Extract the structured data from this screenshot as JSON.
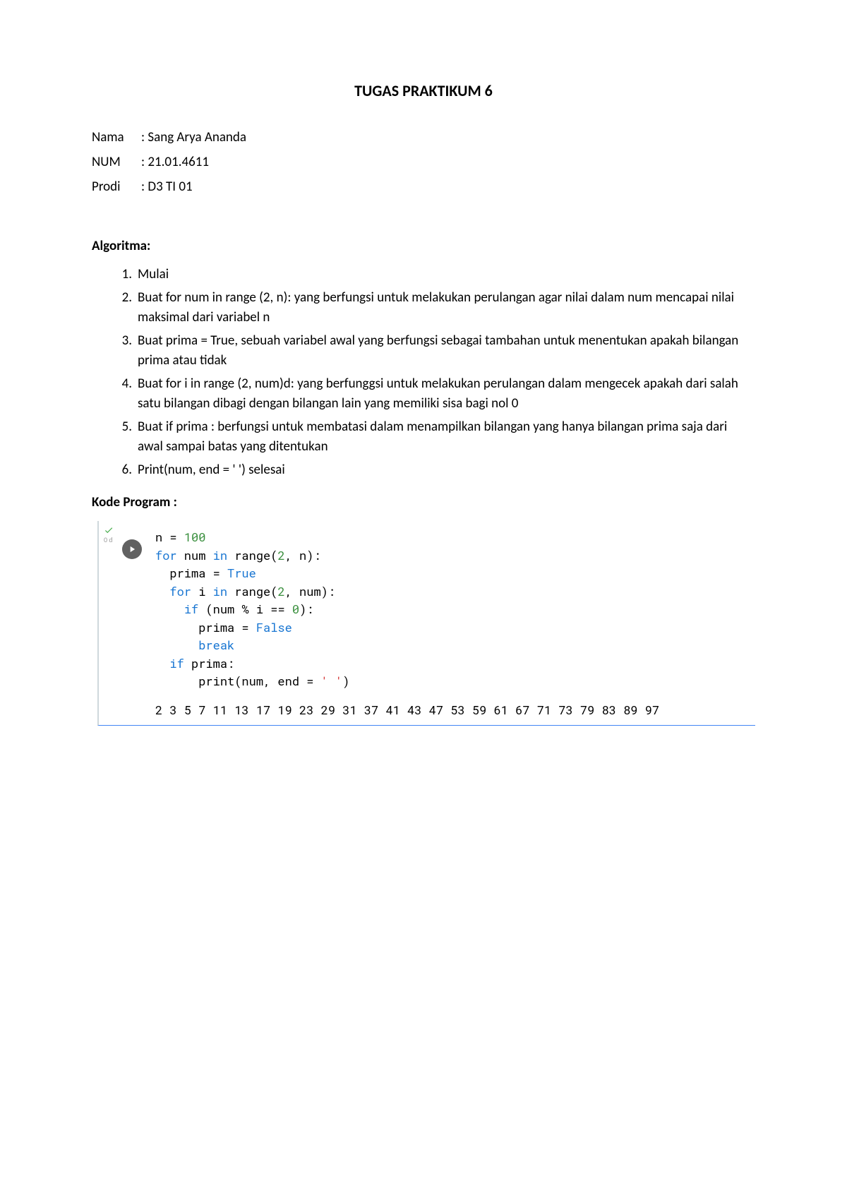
{
  "title": "TUGAS PRAKTIKUM 6",
  "ident": {
    "nama_label": "Nama",
    "nama_value": ": Sang Arya Ananda",
    "num_label": "NUM",
    "num_value": ": 21.01.4611",
    "prodi_label": "Prodi",
    "prodi_value": ": D3 TI 01"
  },
  "algo_heading": "Algoritma:",
  "algo_items": [
    "Mulai",
    "Buat for num in range (2, n): yang berfungsi untuk melakukan perulangan agar nilai dalam num mencapai nilai maksimal dari variabel n",
    "Buat prima = True, sebuah variabel awal yang berfungsi sebagai tambahan untuk menentukan apakah bilangan prima atau tidak",
    "Buat for i in range (2, num)d: yang berfunggsi untuk melakukan perulangan dalam mengecek apakah dari salah satu bilangan dibagi dengan bilangan lain yang memiliki sisa bagi nol 0",
    "Buat if prima : berfungsi untuk membatasi dalam menampilkan bilangan yang hanya bilangan prima saja dari awal sampai batas yang ditentukan",
    "Print(num, end = ' ') selesai"
  ],
  "kode_heading": "Kode Program :",
  "cell_time": "0 d",
  "code": {
    "l1a": "n ",
    "l1b": "= ",
    "l1c": "100",
    "l2a": "for",
    "l2b": " num ",
    "l2c": "in",
    "l2d": " range(",
    "l2e": "2",
    "l2f": ", n):",
    "l3a": "  prima ",
    "l3b": "= ",
    "l3c": "True",
    "l4a": "  ",
    "l4b": "for",
    "l4c": " i ",
    "l4d": "in",
    "l4e": " range(",
    "l4f": "2",
    "l4g": ", num):",
    "l5a": "    ",
    "l5b": "if",
    "l5c": " (num ",
    "l5d": "%",
    "l5e": " i ",
    "l5f": "==",
    "l5g": " ",
    "l5h": "0",
    "l5i": "):",
    "l6a": "      prima ",
    "l6b": "= ",
    "l6c": "False",
    "l7a": "      ",
    "l7b": "break",
    "l8a": "  ",
    "l8b": "if",
    "l8c": " prima:",
    "l9a": "      print(num, end ",
    "l9b": "= ",
    "l9c": "' '",
    "l9d": ")"
  },
  "output": "2 3 5 7 11 13 17 19 23 29 31 37 41 43 47 53 59 61 67 71 73 79 83 89 97 "
}
